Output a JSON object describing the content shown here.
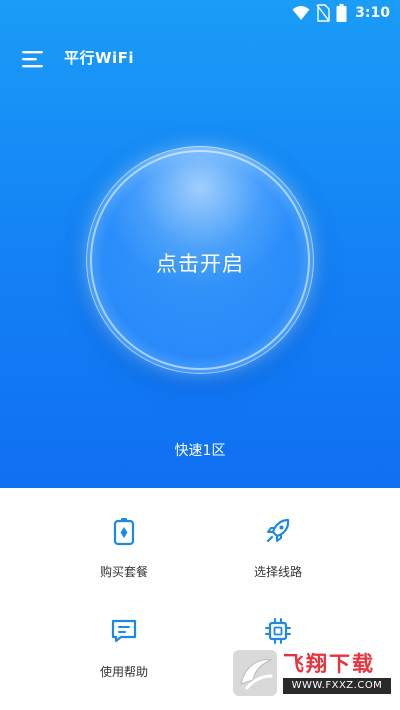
{
  "status_bar": {
    "time": "3:10",
    "icons": [
      "wifi-icon",
      "no-sim-icon",
      "battery-icon"
    ]
  },
  "header": {
    "menu_icon": "hamburger-menu-icon",
    "title": "平行WiFi"
  },
  "main": {
    "connect_button_label": "点击开启",
    "zone_label": "快速1区"
  },
  "features": [
    {
      "label": "购买套餐",
      "icon": "battery-package-icon"
    },
    {
      "label": "选择线路",
      "icon": "rocket-icon"
    },
    {
      "label": "使用帮助",
      "icon": "chat-help-icon"
    },
    {
      "label": "",
      "icon": "chip-icon"
    }
  ],
  "watermark": {
    "brand": "飞翔下载",
    "url": "WWW.FXXZ.COM"
  },
  "colors": {
    "primary_blue": "#1585f5",
    "icon_blue": "#1e88e5",
    "watermark_red": "#e8323c"
  }
}
